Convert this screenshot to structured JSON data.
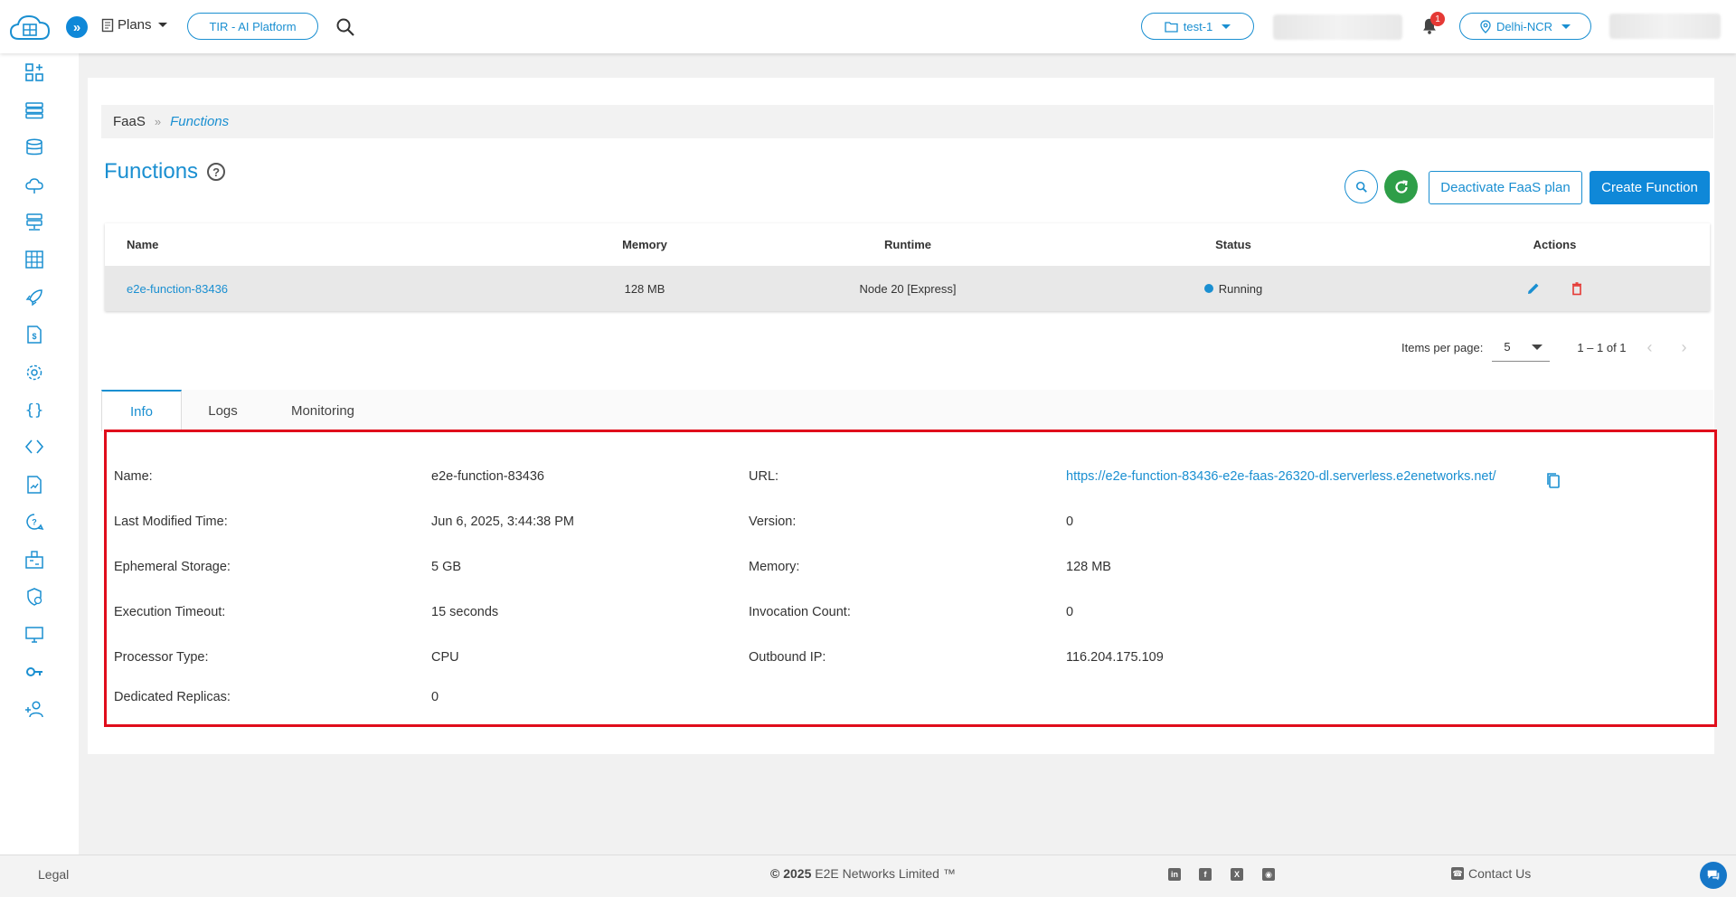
{
  "header": {
    "plans_label": "Plans",
    "tir_label": "TIR - AI Platform",
    "project_label": "test-1",
    "notification_count": "1",
    "region_label": "Delhi-NCR"
  },
  "breadcrumb": {
    "root": "FaaS",
    "separator": "»",
    "current": "Functions"
  },
  "page": {
    "title": "Functions",
    "help_glyph": "?"
  },
  "buttons": {
    "deactivate": "Deactivate FaaS plan",
    "create": "Create Function"
  },
  "table": {
    "columns": [
      "Name",
      "Memory",
      "Runtime",
      "Status",
      "Actions"
    ],
    "rows": [
      {
        "name": "e2e-function-83436",
        "memory": "128 MB",
        "runtime": "Node 20 [Express]",
        "status": "Running"
      }
    ]
  },
  "paginator": {
    "items_per_page_label": "Items per page:",
    "items_per_page_value": "5",
    "range": "1 – 1 of 1"
  },
  "tabs": [
    "Info",
    "Logs",
    "Monitoring"
  ],
  "info": {
    "left": [
      {
        "label": "Name:",
        "value": "e2e-function-83436"
      },
      {
        "label": "Last Modified Time:",
        "value": "Jun 6, 2025, 3:44:38 PM"
      },
      {
        "label": "Ephemeral Storage:",
        "value": "5 GB"
      },
      {
        "label": "Execution Timeout:",
        "value": "15 seconds"
      },
      {
        "label": "Processor Type:",
        "value": "CPU"
      },
      {
        "label": "Dedicated Replicas:",
        "value": "0"
      }
    ],
    "right": [
      {
        "label": "URL:",
        "value": "https://e2e-function-83436-e2e-faas-26320-dl.serverless.e2enetworks.net/"
      },
      {
        "label": "Version:",
        "value": "0"
      },
      {
        "label": "Memory:",
        "value": "128 MB"
      },
      {
        "label": "Invocation Count:",
        "value": "0"
      },
      {
        "label": "Outbound IP:",
        "value": "116.204.175.109"
      }
    ]
  },
  "footer": {
    "legal": "Legal",
    "copyright_prefix": "© 2025",
    "brand": "E2E Networks Limited ™",
    "contact": "Contact Us"
  },
  "colors": {
    "accent": "#1a8fd1",
    "success": "#2e9e48",
    "danger": "#e00d1b"
  }
}
